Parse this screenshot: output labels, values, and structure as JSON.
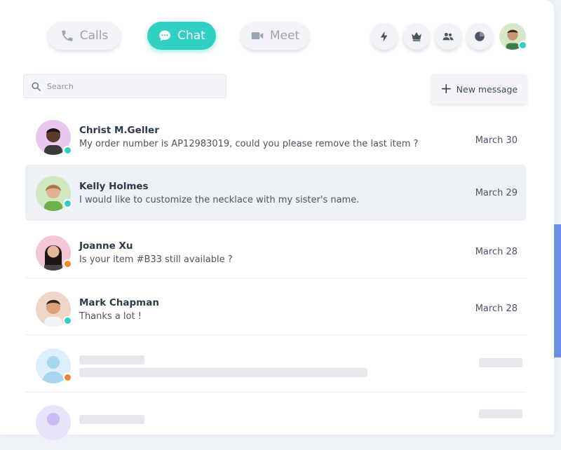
{
  "nav": {
    "calls_label": "Calls",
    "chat_label": "Chat",
    "meet_label": "Meet",
    "active": "Chat"
  },
  "toolbar_icons": [
    "bolt-icon",
    "crown-icon",
    "group-icon",
    "pie-chart-icon"
  ],
  "user": {
    "status": "online"
  },
  "search": {
    "placeholder": "Search"
  },
  "new_message": {
    "label": "New message"
  },
  "conversations": [
    {
      "name": "Christ M.Geller",
      "preview": "My order number is AP12983019, could you please remove the last item ?",
      "date": "March 30",
      "status": "online"
    },
    {
      "name": "Kelly Holmes",
      "preview": "I would like to customize the necklace with my sister's name.",
      "date": "March 29",
      "status": "online"
    },
    {
      "name": "Joanne Xu",
      "preview": "Is your item #B33 still available ?",
      "date": "March 28",
      "status": "away"
    },
    {
      "name": "Mark Chapman",
      "preview": "Thanks a lot !",
      "date": "March 28",
      "status": "online"
    }
  ],
  "colors": {
    "accent": "#30d1c4",
    "online": "#2ccfc0",
    "away": "#f5842b",
    "active_row": "#edf1f6",
    "side_accent": "#6f8fe6"
  }
}
